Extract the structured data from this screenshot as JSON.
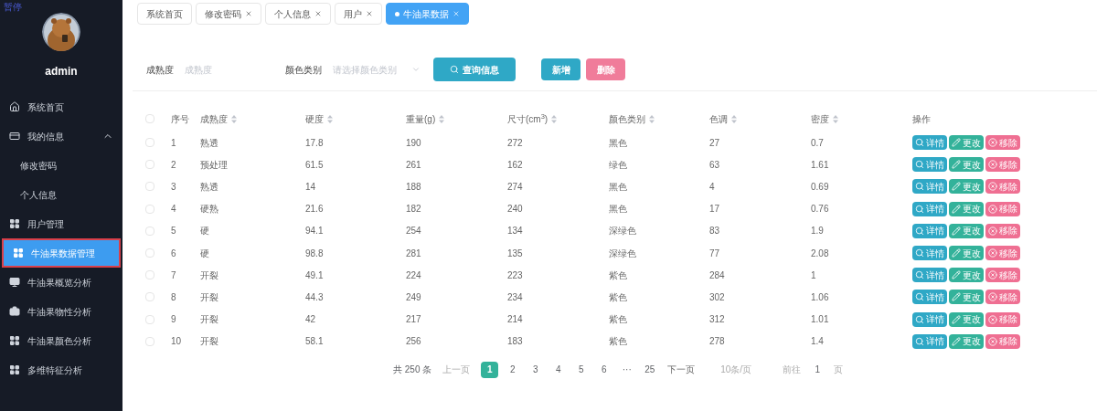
{
  "overlay_label": "暂停",
  "user": {
    "name": "admin"
  },
  "sidebar": {
    "items": [
      {
        "label": "系统首页",
        "kind": "home",
        "selected": false,
        "outlined": false
      },
      {
        "label": "我的信息",
        "kind": "card",
        "selected": false,
        "outlined": false,
        "expanded": true,
        "children": [
          {
            "label": "修改密码",
            "selected": false
          },
          {
            "label": "个人信息",
            "selected": false
          }
        ]
      },
      {
        "label": "用户管理",
        "kind": "grid",
        "selected": false,
        "outlined": false
      },
      {
        "label": "牛油果数据管理",
        "kind": "grid",
        "selected": true,
        "outlined": true
      },
      {
        "label": "牛油果概览分析",
        "kind": "monitor",
        "selected": false,
        "outlined": false
      },
      {
        "label": "牛油果物性分析",
        "kind": "briefcase",
        "selected": false,
        "outlined": false
      },
      {
        "label": "牛油果颜色分析",
        "kind": "grid",
        "selected": false,
        "outlined": false
      },
      {
        "label": "多维特征分析",
        "kind": "grid",
        "selected": false,
        "outlined": false
      }
    ]
  },
  "tabs": [
    {
      "label": "系统首页",
      "selected": false,
      "closable": false
    },
    {
      "label": "修改密码",
      "selected": false,
      "closable": true
    },
    {
      "label": "个人信息",
      "selected": false,
      "closable": true
    },
    {
      "label": "用户",
      "selected": false,
      "closable": true
    },
    {
      "label": "牛油果数据",
      "selected": true,
      "closable": true
    }
  ],
  "filters": [
    {
      "label": "成熟度",
      "placeholder": "成熟度",
      "kind": "input"
    },
    {
      "label": "颜色类别",
      "placeholder": "请选择颜色类别",
      "kind": "select"
    }
  ],
  "search_button": "查询信息",
  "buttons": [
    {
      "label": "新增",
      "kind": "add"
    },
    {
      "label": "删除",
      "kind": "delete"
    }
  ],
  "table": {
    "all_checked": false,
    "columns": [
      {
        "label": "序号",
        "sortable": false
      },
      {
        "label": "成熟度",
        "sortable": true
      },
      {
        "label": "硬度",
        "sortable": true
      },
      {
        "label": "重量(g)",
        "sortable": true
      },
      {
        "label": "尺寸(cm$^{3}$)",
        "sortable": true
      },
      {
        "label": "颜色类别",
        "sortable": true
      },
      {
        "label": "色调",
        "sortable": true
      },
      {
        "label": "密度",
        "sortable": true
      },
      {
        "label": "操作",
        "sortable": false
      }
    ],
    "rows": [
      {
        "checked": false,
        "cells": [
          "1",
          "熟透",
          "17.8",
          "190",
          "272",
          "黑色",
          "27",
          "0.7"
        ],
        "actions": [
          {
            "label": "详情",
            "kind": "view"
          },
          {
            "label": "更改",
            "kind": "edit"
          },
          {
            "label": "移除",
            "kind": "remove"
          }
        ]
      },
      {
        "checked": false,
        "cells": [
          "2",
          "预处理",
          "61.5",
          "261",
          "162",
          "绿色",
          "63",
          "1.61"
        ],
        "actions": [
          {
            "label": "详情",
            "kind": "view"
          },
          {
            "label": "更改",
            "kind": "edit"
          },
          {
            "label": "移除",
            "kind": "remove"
          }
        ]
      },
      {
        "checked": false,
        "cells": [
          "3",
          "熟透",
          "14",
          "188",
          "274",
          "黑色",
          "4",
          "0.69"
        ],
        "actions": [
          {
            "label": "详情",
            "kind": "view"
          },
          {
            "label": "更改",
            "kind": "edit"
          },
          {
            "label": "移除",
            "kind": "remove"
          }
        ]
      },
      {
        "checked": false,
        "cells": [
          "4",
          "硬熟",
          "21.6",
          "182",
          "240",
          "黑色",
          "17",
          "0.76"
        ],
        "actions": [
          {
            "label": "详情",
            "kind": "view"
          },
          {
            "label": "更改",
            "kind": "edit"
          },
          {
            "label": "移除",
            "kind": "remove"
          }
        ]
      },
      {
        "checked": false,
        "cells": [
          "5",
          "硬",
          "94.1",
          "254",
          "134",
          "深绿色",
          "83",
          "1.9"
        ],
        "actions": [
          {
            "label": "详情",
            "kind": "view"
          },
          {
            "label": "更改",
            "kind": "edit"
          },
          {
            "label": "移除",
            "kind": "remove"
          }
        ]
      },
      {
        "checked": false,
        "cells": [
          "6",
          "硬",
          "98.8",
          "281",
          "135",
          "深绿色",
          "77",
          "2.08"
        ],
        "actions": [
          {
            "label": "详情",
            "kind": "view"
          },
          {
            "label": "更改",
            "kind": "edit"
          },
          {
            "label": "移除",
            "kind": "remove"
          }
        ]
      },
      {
        "checked": false,
        "cells": [
          "7",
          "开裂",
          "49.1",
          "224",
          "223",
          "紫色",
          "284",
          "1"
        ],
        "actions": [
          {
            "label": "详情",
            "kind": "view"
          },
          {
            "label": "更改",
            "kind": "edit"
          },
          {
            "label": "移除",
            "kind": "remove"
          }
        ]
      },
      {
        "checked": false,
        "cells": [
          "8",
          "开裂",
          "44.3",
          "249",
          "234",
          "紫色",
          "302",
          "1.06"
        ],
        "actions": [
          {
            "label": "详情",
            "kind": "view"
          },
          {
            "label": "更改",
            "kind": "edit"
          },
          {
            "label": "移除",
            "kind": "remove"
          }
        ]
      },
      {
        "checked": false,
        "cells": [
          "9",
          "开裂",
          "42",
          "217",
          "214",
          "紫色",
          "312",
          "1.01"
        ],
        "actions": [
          {
            "label": "详情",
            "kind": "view"
          },
          {
            "label": "更改",
            "kind": "edit"
          },
          {
            "label": "移除",
            "kind": "remove"
          }
        ]
      },
      {
        "checked": false,
        "cells": [
          "10",
          "开裂",
          "58.1",
          "256",
          "183",
          "紫色",
          "278",
          "1.4"
        ],
        "actions": [
          {
            "label": "详情",
            "kind": "view"
          },
          {
            "label": "更改",
            "kind": "edit"
          },
          {
            "label": "移除",
            "kind": "remove"
          }
        ]
      }
    ]
  },
  "pagination": {
    "total": "共 250 条",
    "prev": "上一页",
    "pages": [
      {
        "label": "1",
        "selected": true
      },
      {
        "label": "2",
        "selected": false
      },
      {
        "label": "3",
        "selected": false
      },
      {
        "label": "4",
        "selected": false
      },
      {
        "label": "5",
        "selected": false
      },
      {
        "label": "6",
        "selected": false
      },
      {
        "label": "···",
        "selected": false
      },
      {
        "label": "25",
        "selected": false
      }
    ],
    "next": "下一页",
    "page_size": "10条/页",
    "goto_label": "前往",
    "goto_value": "1",
    "goto_suffix": "页"
  }
}
